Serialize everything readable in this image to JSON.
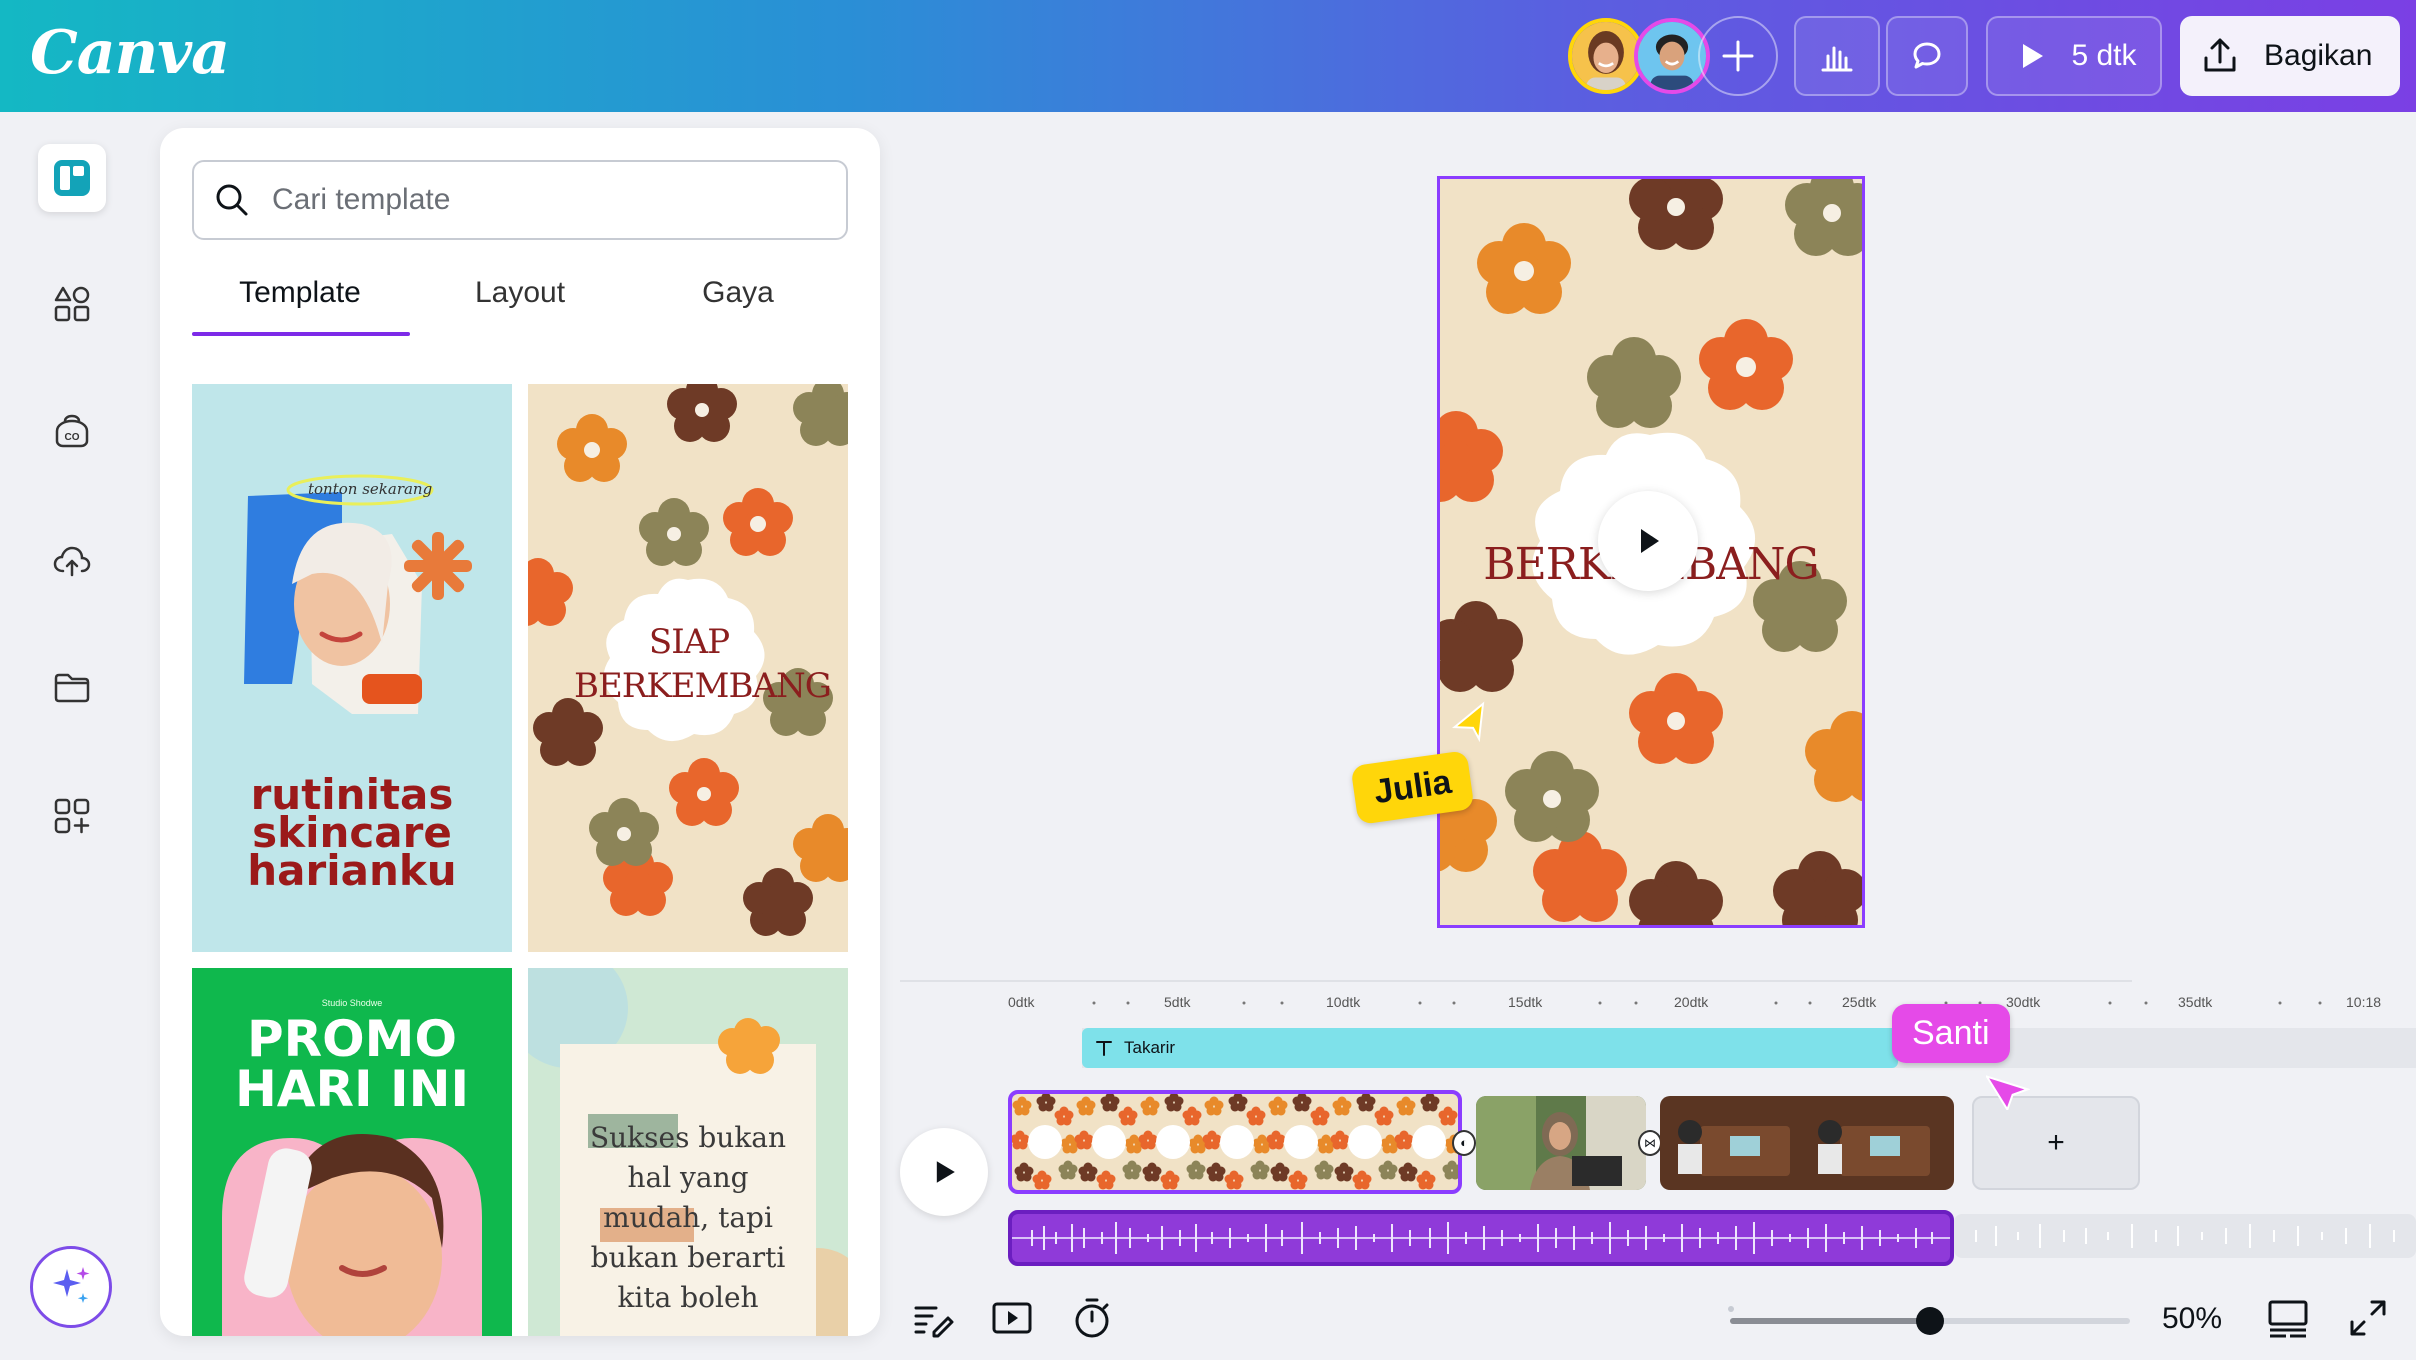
{
  "app": {
    "logo": "Canva"
  },
  "header": {
    "play_label": "5 dtk",
    "share_label": "Bagikan"
  },
  "panel": {
    "search_placeholder": "Cari template",
    "tabs": [
      {
        "label": "Template",
        "active": true
      },
      {
        "label": "Layout",
        "active": false
      },
      {
        "label": "Gaya",
        "active": false
      }
    ],
    "templates": [
      {
        "small_text": "tonton sekarang",
        "title": "rutinitas skincare harianku"
      },
      {
        "title": "SIAP BERKEMBANG"
      },
      {
        "small_text": "Studio Shodwe",
        "title": "PROMO HARI INI"
      },
      {
        "title": "Sukses bukan hal yang mudah, tapi bukan berarti kita boleh"
      }
    ]
  },
  "canvas": {
    "title_text": "BERKEMBANG"
  },
  "collaborators": {
    "julia": "Julia",
    "santi": "Santi"
  },
  "timeline": {
    "ruler": [
      "0dtk",
      "5dtk",
      "10dtk",
      "15dtk",
      "20dtk",
      "25dtk",
      "30dtk",
      "35dtk",
      "10:18"
    ],
    "caption_track_label": "Takarir",
    "add_clip_label": "+"
  },
  "footer": {
    "zoom": "50%",
    "zoom_level": 0.5
  },
  "colors": {
    "accent": "#8b3dff",
    "caption_track": "#7ee1ea",
    "audio_track": "#8f3ad9",
    "julia_tag": "#ffd60a",
    "santi_tag": "#e54ae8",
    "pattern_bg": "#f1e2c6"
  }
}
